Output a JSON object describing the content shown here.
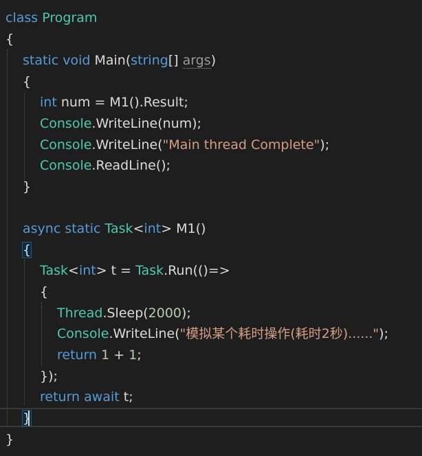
{
  "code": {
    "l1": {
      "kw1": "class",
      "type1": "Program"
    },
    "l2": {
      "p1": "{"
    },
    "l3": {
      "kw1": "static",
      "kw2": "void",
      "p1": "Main(",
      "kw3": "string",
      "p2": "[]",
      "dim1": "args",
      "p3": ")"
    },
    "l4": {
      "p1": "{"
    },
    "l5": {
      "kw1": "int",
      "p1": "num = M1().Result;"
    },
    "l6": {
      "type1": "Console",
      "p1": ".WriteLine(num);"
    },
    "l7": {
      "type1": "Console",
      "p1": ".WriteLine(",
      "str1": "\"Main thread Complete\"",
      "p2": ");"
    },
    "l8": {
      "type1": "Console",
      "p1": ".ReadLine();"
    },
    "l9": {
      "p1": "}"
    },
    "l11": {
      "kw1": "async",
      "kw2": "static",
      "type1": "Task",
      "p1": "<",
      "kw3": "int",
      "p2": "> M1()"
    },
    "l12": {
      "p1": "{"
    },
    "l13": {
      "type1": "Task",
      "p1": "<",
      "kw1": "int",
      "p2": "> t = ",
      "type2": "Task",
      "p3": ".Run(()=>"
    },
    "l14": {
      "p1": "{"
    },
    "l15": {
      "type1": "Thread",
      "p1": ".Sleep(",
      "num1": "2000",
      "p2": ");"
    },
    "l16": {
      "type1": "Console",
      "p1": ".WriteLine(",
      "str1": "\"模拟某个耗时操作(耗时2秒)......\"",
      "p2": ");"
    },
    "l17": {
      "kw1": "return",
      "num1": "1",
      "p1": " + ",
      "num2": "1",
      "p2": ";"
    },
    "l18": {
      "p1": "});"
    },
    "l19": {
      "kw1": "return",
      "kw2": "await",
      "p1": "t;"
    },
    "l20": {
      "p1": "}"
    },
    "l21": {
      "p1": "}"
    }
  },
  "colors": {
    "background": "#1e1e1e",
    "keyword": "#569cd6",
    "type": "#4ec9b0",
    "string": "#d69d85",
    "number": "#b5cea8",
    "plain": "#dcdcdc"
  }
}
